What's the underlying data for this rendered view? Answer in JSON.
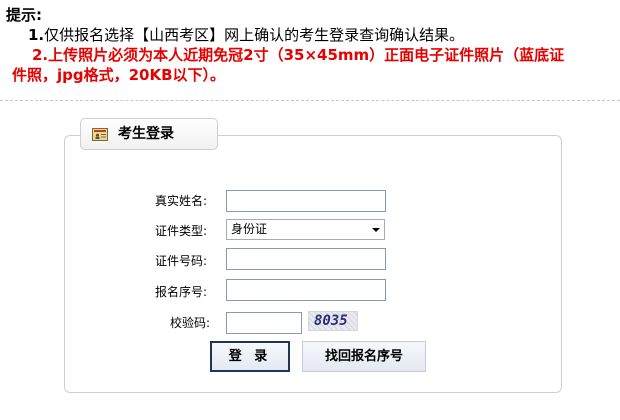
{
  "notice": {
    "title": "提示:",
    "line1_number": "1.",
    "line1_text": "仅供报名选择【山西考区】网上确认的考生登录查询确认结果。",
    "line2_text": "2.上传照片必须为本人近期免冠2寸（35×45mm）正面电子证件照片（蓝底证",
    "line3_text": "件照，jpg格式，20KB以下）。"
  },
  "login": {
    "header_title": "考生登录",
    "header_icon": "id-card-icon",
    "fields": {
      "name_label": "真实姓名:",
      "name_value": "",
      "id_type_label": "证件类型:",
      "id_type_selected": "身份证",
      "id_number_label": "证件号码:",
      "id_number_value": "",
      "reg_number_label": "报名序号:",
      "reg_number_value": "",
      "captcha_label": "校验码:",
      "captcha_value": "",
      "captcha_image_text": "8035"
    },
    "buttons": {
      "login_label": "登 录",
      "recover_label": "找回报名序号"
    }
  },
  "colors": {
    "notice_red": "#e60000",
    "login_border": "#1d3558",
    "input_border": "#7f9db9"
  }
}
